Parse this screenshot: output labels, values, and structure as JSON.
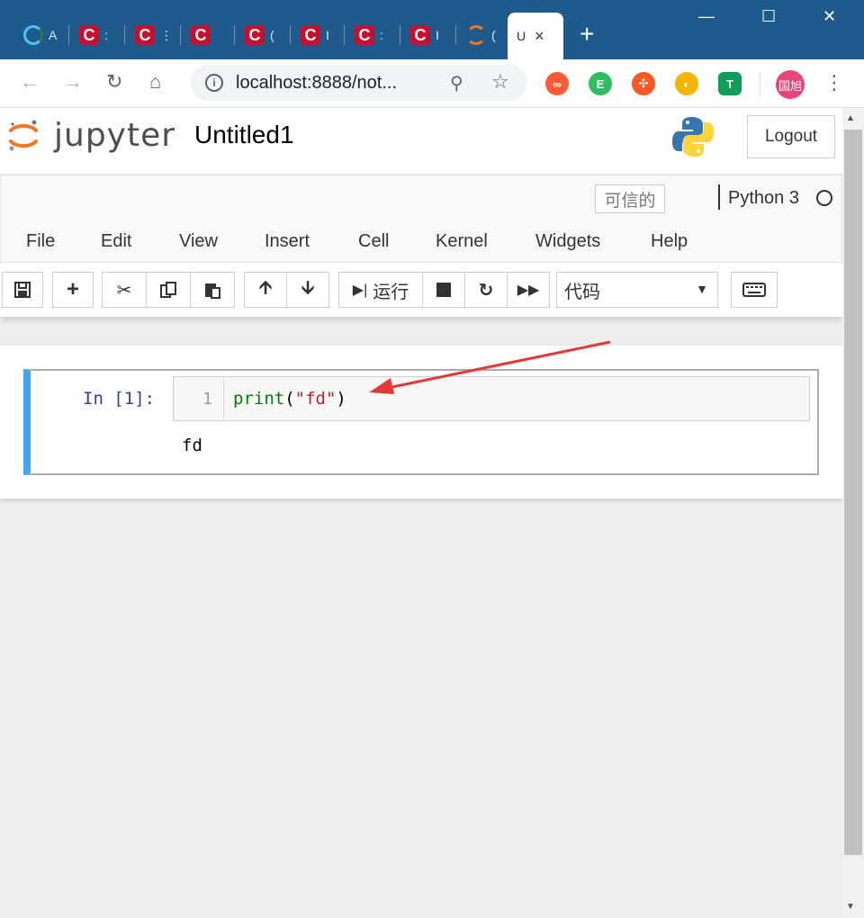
{
  "browser": {
    "tabs": [
      {
        "title": "A",
        "icon": "loading-ring-icon"
      },
      {
        "title": ":",
        "icon": "csdn-icon"
      },
      {
        "title": "⋮",
        "icon": "csdn-icon"
      },
      {
        "title": "",
        "icon": "csdn-icon"
      },
      {
        "title": "(",
        "icon": "csdn-icon"
      },
      {
        "title": "I",
        "icon": "csdn-icon"
      },
      {
        "title": ":",
        "icon": "csdn-icon"
      },
      {
        "title": "I",
        "icon": "csdn-icon"
      },
      {
        "title": "(",
        "icon": "jupyter-icon"
      }
    ],
    "active_tab": {
      "title": "U",
      "close": "×"
    },
    "new_tab": "+",
    "window": {
      "minimize": "—",
      "maximize": "☐",
      "close": "✕"
    },
    "url": "localhost:8888/not...",
    "avatar_text": "国旭",
    "extensions": [
      {
        "name": "infinity-ext-icon",
        "color": "#ff5a36",
        "glyph": "∞"
      },
      {
        "name": "evernote-ext-icon",
        "color": "#2dbe60",
        "glyph": "E"
      },
      {
        "name": "mindmap-ext-icon",
        "color": "#ff5722",
        "glyph": "✣"
      },
      {
        "name": "chrome-like-ext-icon",
        "color": "#f4b400",
        "glyph": "◐"
      },
      {
        "name": "shield-t-ext-icon",
        "color": "#0f9d58",
        "glyph": "T"
      }
    ]
  },
  "jupyter": {
    "logo_text": "jupyter",
    "notebook_title": "Untitled1",
    "logout_label": "Logout",
    "trusted_label": "可信的",
    "kernel_name": "Python 3",
    "menu": [
      "File",
      "Edit",
      "View",
      "Insert",
      "Cell",
      "Kernel",
      "Widgets",
      "Help"
    ],
    "toolbar": {
      "run_label": "运行",
      "cell_type": "代码"
    },
    "cell": {
      "prompt": "In  [1]:",
      "line_number": "1",
      "code_fn": "print",
      "code_open": "(",
      "code_str": "\"fd\"",
      "code_close": ")",
      "output": "fd"
    }
  },
  "colors": {
    "tabstrip": "#1e5b8c",
    "cell_selected_border": "#42a5f5",
    "annotation_arrow": "#e53935"
  }
}
